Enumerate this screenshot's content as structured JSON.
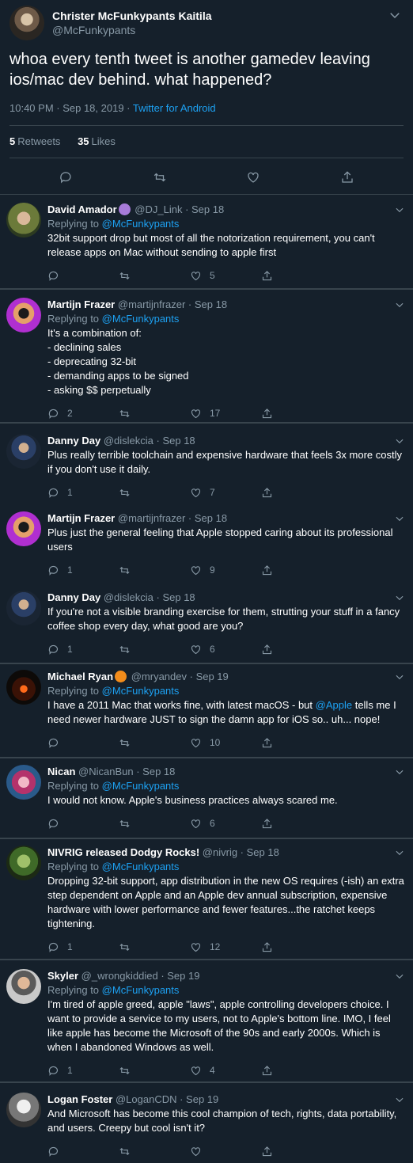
{
  "main": {
    "name": "Christer McFunkypants Kaitila",
    "handle": "@McFunkypants",
    "text": "whoa every tenth tweet is another gamedev leaving ios/mac dev behind. what happened?",
    "time": "10:40 PM · Sep 18, 2019 · ",
    "source": "Twitter for Android",
    "retweets": "5",
    "retweets_label": "Retweets",
    "likes": "35",
    "likes_label": "Likes"
  },
  "replies": [
    {
      "name": "David Amador",
      "badge": "octopus",
      "handle": "@DJ_Link",
      "date": "Sep 18",
      "replying_label": "Replying to",
      "replying_to": "@McFunkypants",
      "text": "32bit support drop but most of all the notorization requirement, you can't release apps on Mac without sending to apple first",
      "replies": "",
      "likes": "5"
    },
    {
      "name": "Martijn Frazer",
      "handle": "@martijnfrazer",
      "date": "Sep 18",
      "replying_label": "Replying to",
      "replying_to": "@McFunkypants",
      "text": "It's a combination of:\n- declining sales\n- deprecating 32-bit\n- demanding apps to be signed\n- asking $$ perpetually",
      "replies": "2",
      "likes": "17"
    },
    {
      "name": "Danny Day",
      "handle": "@dislekcia",
      "date": "Sep 18",
      "text": "Plus really terrible toolchain and expensive hardware that feels 3x more costly if you don't use it daily.",
      "replies": "1",
      "likes": "7"
    },
    {
      "name": "Martijn Frazer",
      "handle": "@martijnfrazer",
      "date": "Sep 18",
      "text": "Plus just the general feeling that Apple stopped caring about its professional users",
      "replies": "1",
      "likes": "9"
    },
    {
      "name": "Danny Day",
      "handle": "@dislekcia",
      "date": "Sep 18",
      "text": "If you're not a visible branding exercise for them, strutting your stuff in a fancy coffee shop every day, what good are you?",
      "replies": "1",
      "likes": "6"
    },
    {
      "name": "Michael Ryan",
      "badge": "pumpkin",
      "handle": "@mryandev",
      "date": "Sep 19",
      "replying_label": "Replying to",
      "replying_to": "@McFunkypants",
      "text_before": "I have a 2011 Mac that works fine, with latest macOS  - but ",
      "mention": "@Apple",
      "text_after": " tells me I need newer hardware JUST to sign the damn app for iOS so.. uh... nope!",
      "replies": "",
      "likes": "10"
    },
    {
      "name": "Nican",
      "handle": "@NicanBun",
      "date": "Sep 18",
      "replying_label": "Replying to",
      "replying_to": "@McFunkypants",
      "text": "I would not know. Apple's business practices always scared me.",
      "replies": "",
      "likes": "6"
    },
    {
      "name": "NIVRIG released Dodgy Rocks!",
      "handle": "@nivrig",
      "date": "Sep 18",
      "replying_label": "Replying to",
      "replying_to": "@McFunkypants",
      "text": "Dropping 32-bit support, app distribution in the new OS requires (-ish) an extra step dependent on Apple and an Apple dev annual subscription, expensive hardware with lower performance and fewer features...the ratchet keeps tightening.",
      "replies": "1",
      "likes": "12"
    },
    {
      "name": "Skyler",
      "handle": "@_wrongkiddied",
      "date": "Sep 19",
      "replying_label": "Replying to",
      "replying_to": "@McFunkypants",
      "text": "I'm tired of apple greed, apple \"laws\", apple controlling developers choice. I want to provide a service to my users, not to Apple's bottom line. IMO, I feel like apple has become the Microsoft of the 90s and early 2000s. Which is when I abandoned Windows as well.",
      "replies": "1",
      "likes": "4"
    },
    {
      "name": "Logan Foster",
      "handle": "@LoganCDN",
      "date": "Sep 19",
      "text": "And Microsoft has become this cool champion of tech, rights, data portability, and users. Creepy but cool isn't it?",
      "replies": "",
      "likes": ""
    }
  ],
  "colors": {
    "background": "#15202b",
    "border": "#38444d",
    "muted": "#8899a6",
    "link": "#1da1f2",
    "text": "#ffffff"
  }
}
